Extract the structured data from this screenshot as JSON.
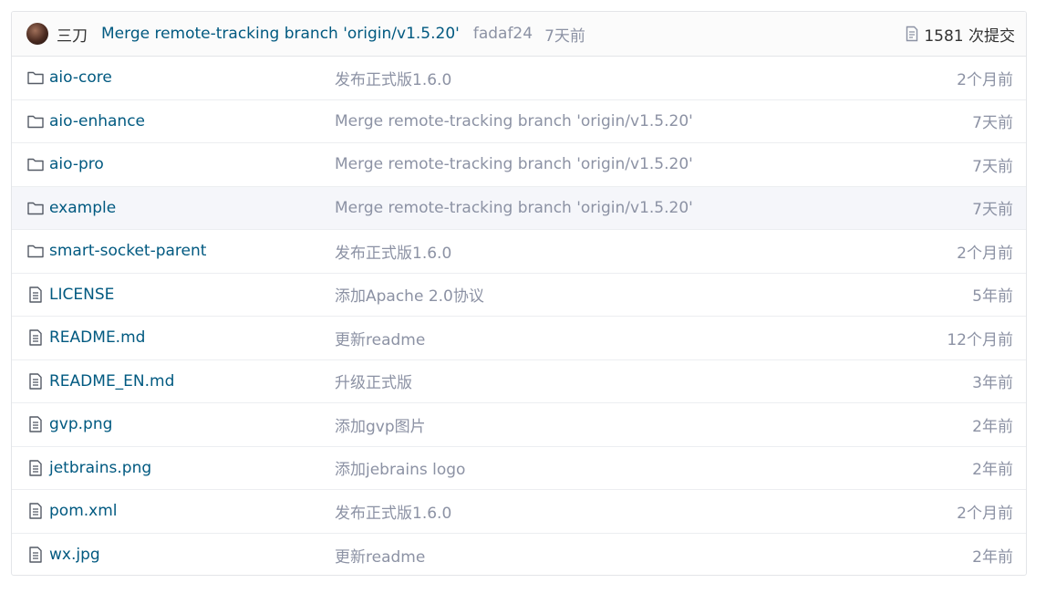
{
  "latest_commit": {
    "author": "三刀",
    "message": "Merge remote-tracking branch 'origin/v1.5.20'",
    "sha": "fadaf24",
    "time": "7天前",
    "commit_count_label": "1581 次提交"
  },
  "files": [
    {
      "name": "aio-core",
      "type": "folder",
      "message": "发布正式版1.6.0",
      "time": "2个月前"
    },
    {
      "name": "aio-enhance",
      "type": "folder",
      "message": "Merge remote-tracking branch 'origin/v1.5.20'",
      "time": "7天前"
    },
    {
      "name": "aio-pro",
      "type": "folder",
      "message": "Merge remote-tracking branch 'origin/v1.5.20'",
      "time": "7天前"
    },
    {
      "name": "example",
      "type": "folder",
      "message": "Merge remote-tracking branch 'origin/v1.5.20'",
      "time": "7天前"
    },
    {
      "name": "smart-socket-parent",
      "type": "folder",
      "message": "发布正式版1.6.0",
      "time": "2个月前"
    },
    {
      "name": "LICENSE",
      "type": "file",
      "message": "添加Apache 2.0协议",
      "time": "5年前"
    },
    {
      "name": "README.md",
      "type": "file",
      "message": "更新readme",
      "time": "12个月前"
    },
    {
      "name": "README_EN.md",
      "type": "file",
      "message": "升级正式版",
      "time": "3年前"
    },
    {
      "name": "gvp.png",
      "type": "file",
      "message": "添加gvp图片",
      "time": "2年前"
    },
    {
      "name": "jetbrains.png",
      "type": "file",
      "message": "添加jebrains logo",
      "time": "2年前"
    },
    {
      "name": "pom.xml",
      "type": "file",
      "message": "发布正式版1.6.0",
      "time": "2个月前"
    },
    {
      "name": "wx.jpg",
      "type": "file",
      "message": "更新readme",
      "time": "2年前"
    }
  ],
  "colors": {
    "link": "#005980",
    "muted": "#8c92a4",
    "border": "#e3e5e8",
    "hover_row": "#f5f6fa"
  }
}
